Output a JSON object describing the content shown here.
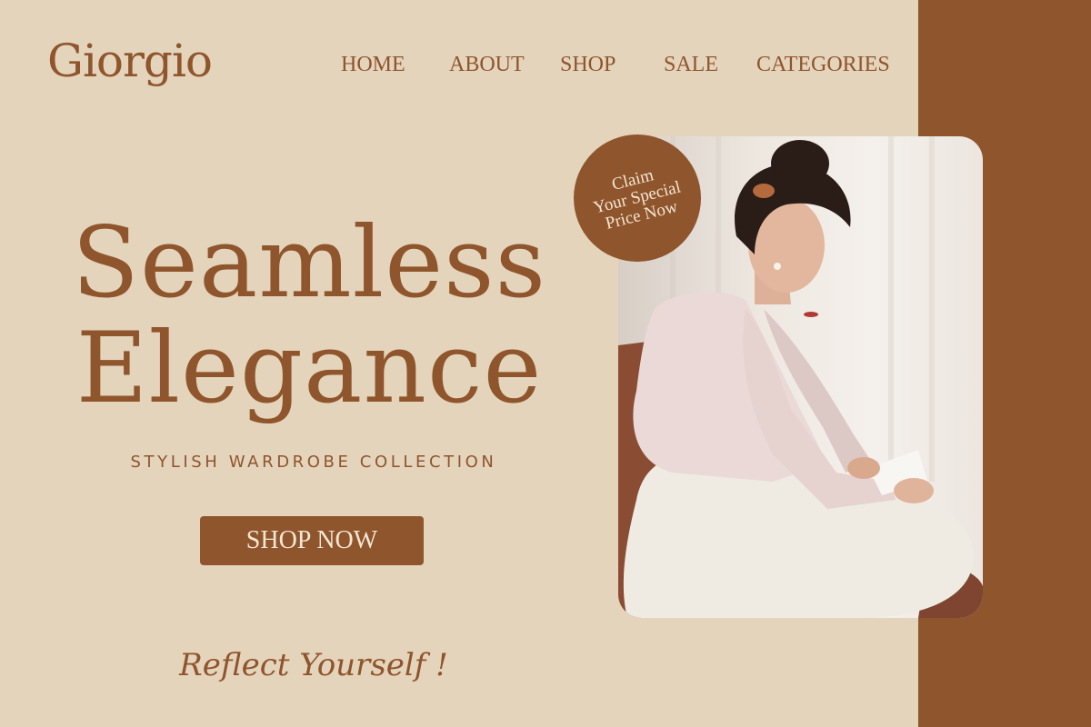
{
  "brand": {
    "logo": "Giorgio"
  },
  "nav": {
    "items": [
      "HOME",
      "ABOUT",
      "SHOP",
      "SALE",
      "CATEGORIES"
    ]
  },
  "hero": {
    "line1": "Seamless",
    "line2": "Elegance",
    "subtitle": "STYLISH WARDROBE COLLECTION",
    "cta": "SHOP NOW",
    "tagline": "Reflect Yourself !"
  },
  "badge": {
    "lines": [
      "Claim",
      "Your Special",
      "Price Now"
    ]
  },
  "colors": {
    "background": "#e4d4bc",
    "accent": "#8f552c",
    "badge_text": "#f3e6d3"
  }
}
